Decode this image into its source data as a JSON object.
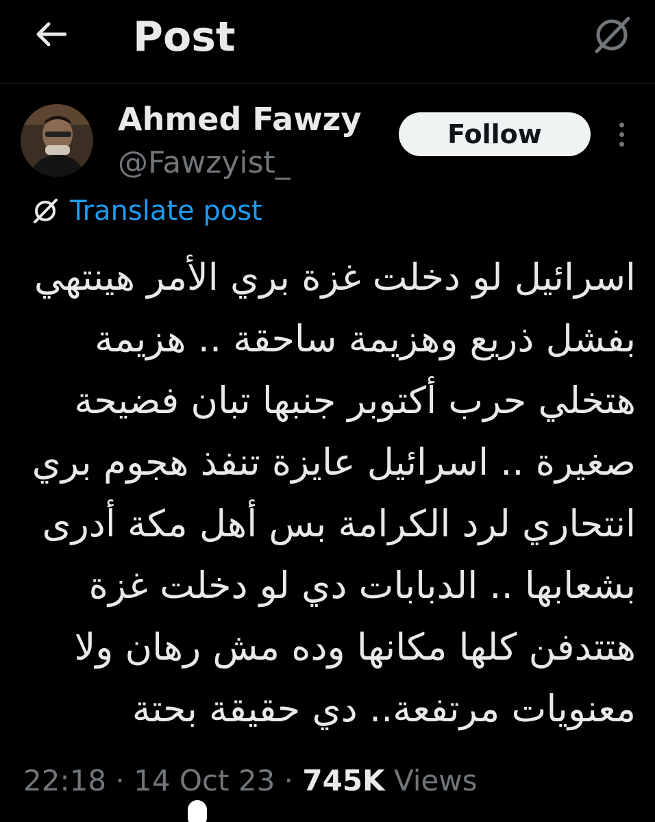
{
  "header": {
    "title": "Post",
    "back_icon": "arrow-left-icon",
    "grok_icon": "grok-slash-icon"
  },
  "author": {
    "name": "Ahmed Fawzy",
    "handle": "@Fawzyist_",
    "follow_label": "Follow",
    "more_icon": "vertical-ellipsis-icon"
  },
  "translate": {
    "label": "Translate post",
    "icon": "grok-slash-icon"
  },
  "post": {
    "lines": [
      "اسرائيل لو دخلت غزة بري الأمر هينتهي",
      "بفشل ذريع وهزيمة ساحقة .. هزيمة",
      "هتخلي حرب أكتوبر جنبها تبان فضيحة",
      "صغيرة .. اسرائيل عايزة تنفذ هجوم بري",
      "انتحاري لرد الكرامة بس أهل مكة أدرى",
      "بشعابها .. الدبابات دي لو دخلت غزة",
      "هتتدفن كلها مكانها وده مش رهان ولا",
      "معنويات مرتفعة.. دي حقيقة بحتة"
    ]
  },
  "meta": {
    "time": "22:18",
    "sep1": " · ",
    "date": "14 Oct 23",
    "sep2": " · ",
    "views_count": "745K",
    "views_label": " Views"
  },
  "colors": {
    "background": "#000000",
    "text": "#e7e9ea",
    "secondary": "#71767b",
    "link": "#1d9bf0",
    "follow_bg": "#eff3f4"
  }
}
